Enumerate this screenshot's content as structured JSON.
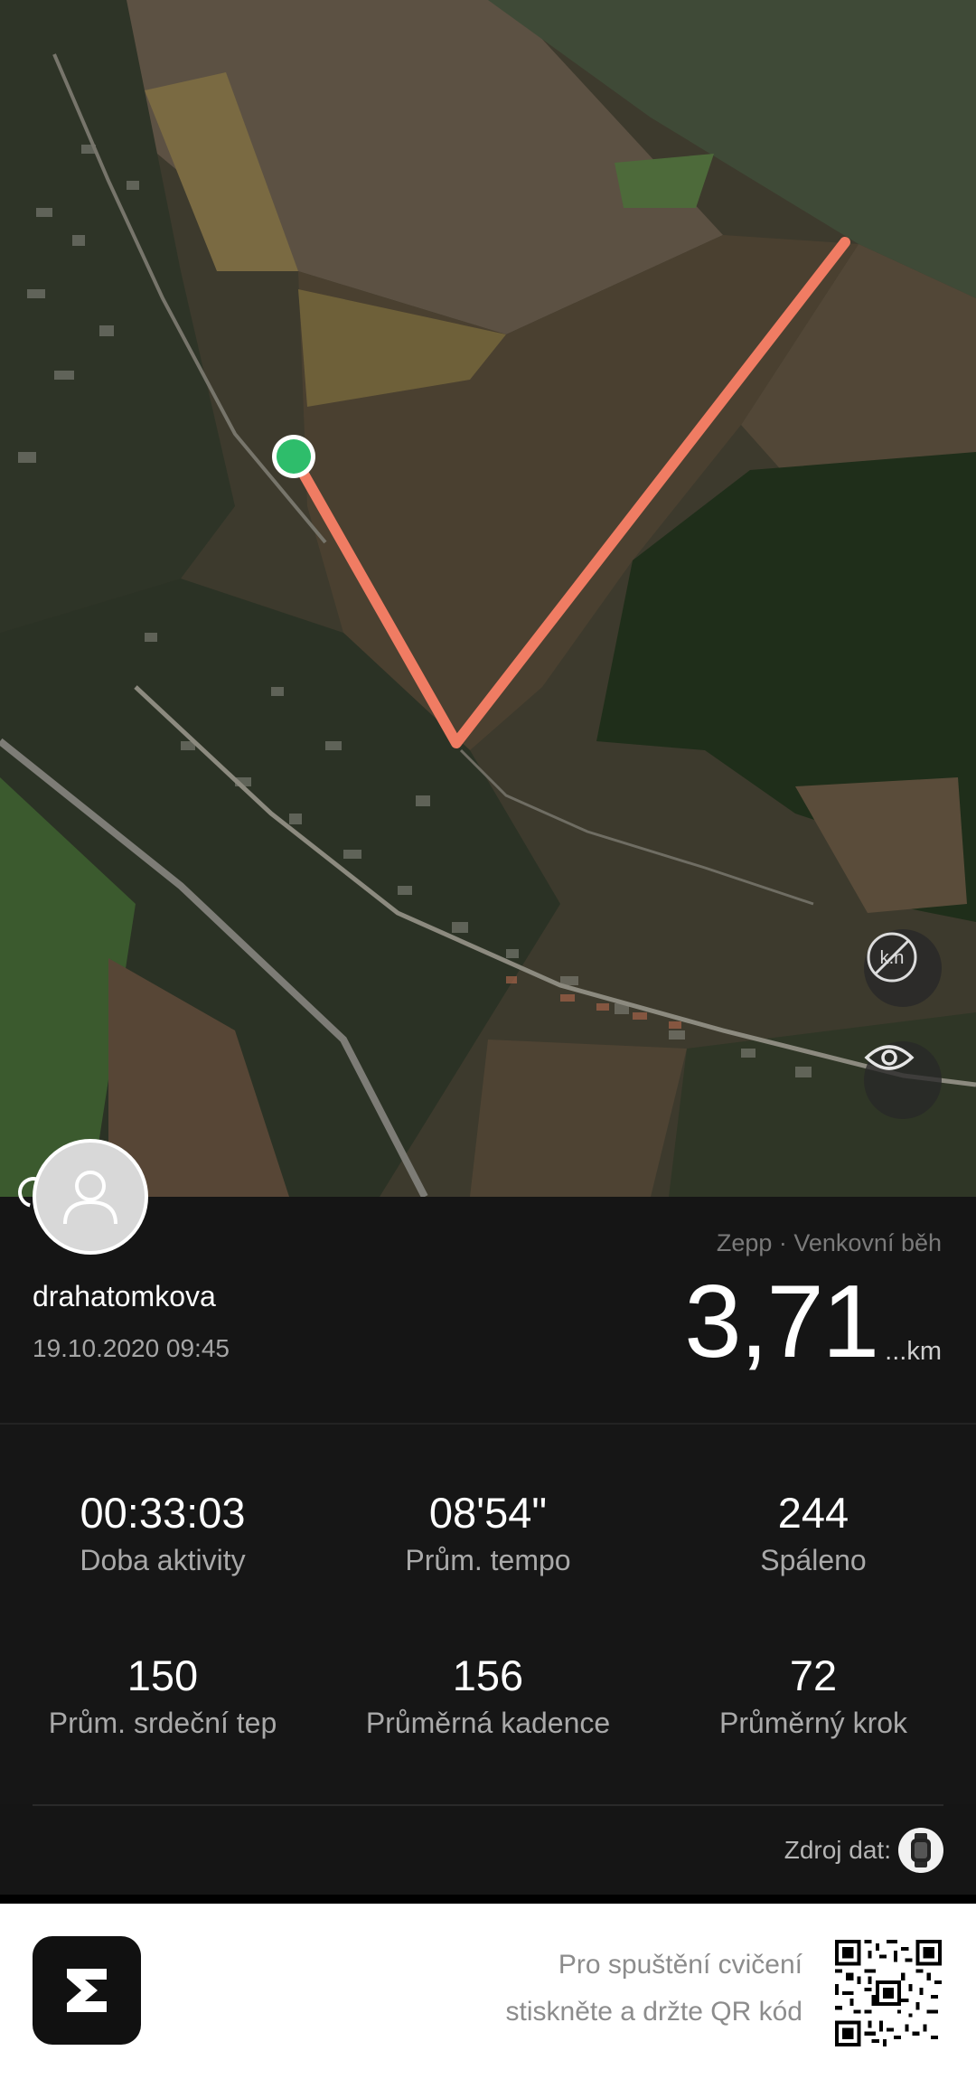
{
  "map": {
    "route_color": "#f07c63",
    "start_marker_color": "#2ebd6b",
    "buttons": [
      {
        "icon": "km-marker-toggle-icon"
      },
      {
        "icon": "eye-icon"
      }
    ]
  },
  "profile": {
    "username": "drahatomkova",
    "datetime": "19.10.2020 09:45",
    "avatar_icon": "user-avatar-icon"
  },
  "activity": {
    "source_label": "Zepp · Venkovní běh",
    "distance": "3,71",
    "distance_unit": "...km"
  },
  "stats": [
    {
      "value": "00:33:03",
      "label": "Doba aktivity"
    },
    {
      "value": "08'54\"",
      "label": "Prům. tempo"
    },
    {
      "value": "244",
      "label": "Spáleno"
    },
    {
      "value": "150",
      "label": "Prům. srdeční tep"
    },
    {
      "value": "156",
      "label": "Průměrná kadence"
    },
    {
      "value": "72",
      "label": "Průměrný krok"
    }
  ],
  "data_source": {
    "label": "Zdroj dat:",
    "icon": "watch-icon"
  },
  "footer": {
    "line1": "Pro spuštění cvičení",
    "line2": "stiskněte a držte QR kód",
    "logo_icon": "zepp-logo-icon",
    "qr_icon": "qr-code-icon"
  }
}
